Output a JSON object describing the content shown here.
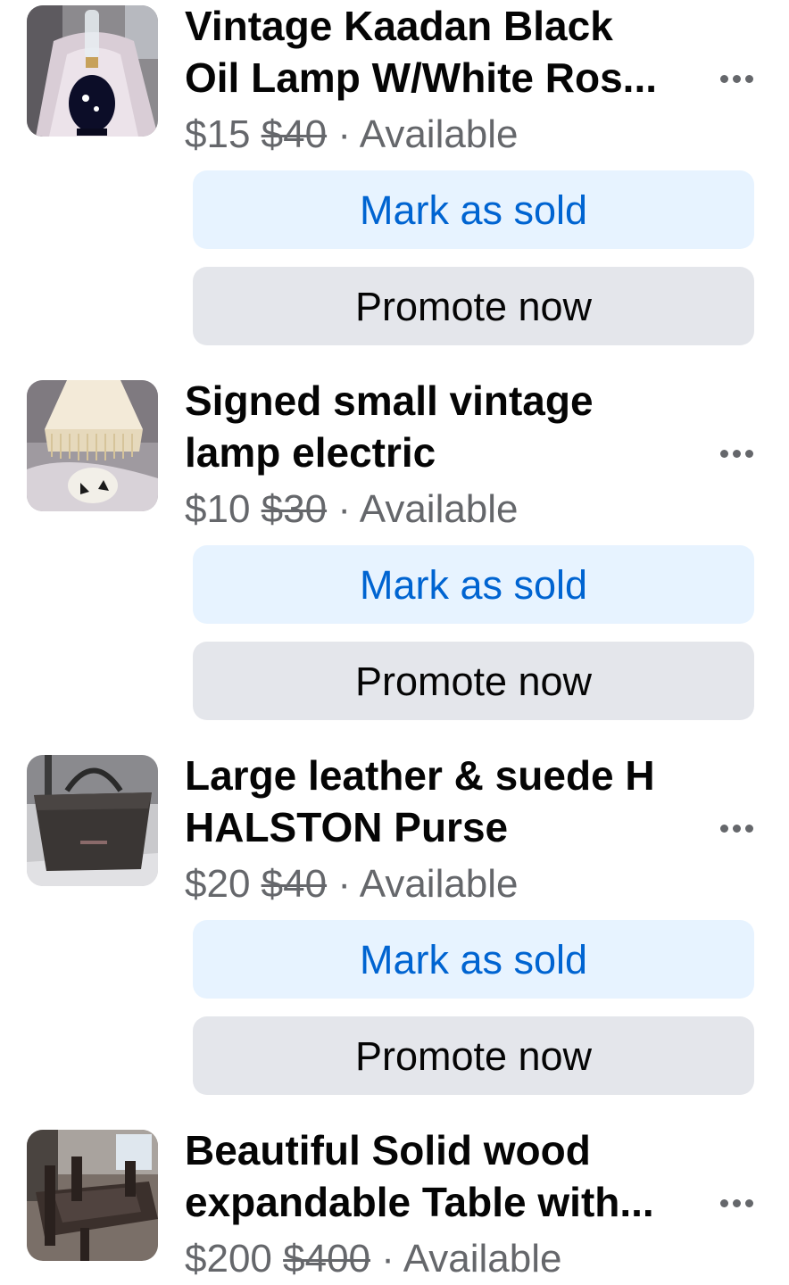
{
  "listings": [
    {
      "title_line1": "Vintage Kaadan Black",
      "title_line2": "Oil Lamp W/White Ros...",
      "price": "$15",
      "original_price": "$40",
      "separator": "·",
      "status": "Available",
      "mark_sold_label": "Mark as sold",
      "promote_label": "Promote now",
      "thumbnail": "black-oil-lamp-photo"
    },
    {
      "title_line1": "Signed small vintage",
      "title_line2": "lamp electric",
      "price": "$10",
      "original_price": "$30",
      "separator": "·",
      "status": "Available",
      "mark_sold_label": "Mark as sold",
      "promote_label": "Promote now",
      "thumbnail": "fringed-lamp-photo"
    },
    {
      "title_line1": "Large leather & suede H",
      "title_line2": "HALSTON Purse",
      "price": "$20",
      "original_price": "$40",
      "separator": "·",
      "status": "Available",
      "mark_sold_label": "Mark as sold",
      "promote_label": "Promote now",
      "thumbnail": "leather-purse-photo"
    },
    {
      "title_line1": "Beautiful Solid wood",
      "title_line2": "expandable Table with...",
      "price": "$200",
      "original_price": "$400",
      "separator": "·",
      "status": "Available",
      "thumbnail": "wood-table-photo"
    }
  ],
  "colors": {
    "primary_button_bg": "#e7f3ff",
    "primary_button_text": "#0064d1",
    "secondary_button_bg": "#e4e6eb",
    "secondary_text": "#65676b",
    "title_text": "#050505"
  },
  "icons": {
    "more": "more-options-icon"
  }
}
